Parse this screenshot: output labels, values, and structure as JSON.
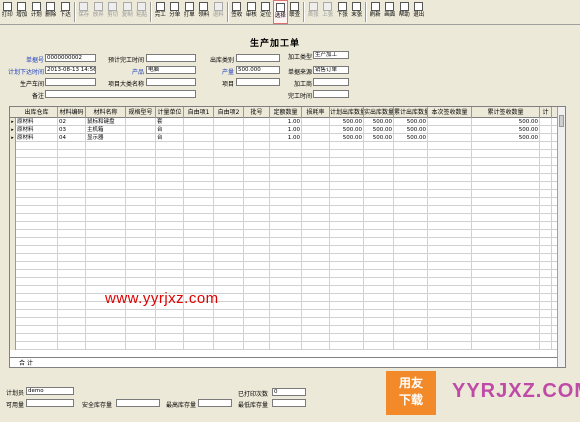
{
  "toolbar": {
    "buttons": [
      {
        "label": "打印",
        "icon": "printer-icon",
        "disabled": false
      },
      {
        "label": "增加",
        "icon": "add-icon",
        "disabled": false
      },
      {
        "label": "计划",
        "icon": "plan-icon",
        "disabled": false
      },
      {
        "label": "删除",
        "icon": "delete-icon",
        "disabled": false
      },
      {
        "label": "下达",
        "icon": "issue-icon",
        "disabled": false
      },
      {
        "label": "保存",
        "icon": "save-icon",
        "disabled": true
      },
      {
        "label": "放弃",
        "icon": "cancel-icon",
        "disabled": true
      },
      {
        "label": "剪切",
        "icon": "cut-icon",
        "disabled": true
      },
      {
        "label": "复制",
        "icon": "copy-icon",
        "disabled": true
      },
      {
        "label": "粘贴",
        "icon": "paste-icon",
        "disabled": true
      },
      {
        "label": "完工",
        "icon": "complete-icon",
        "disabled": false
      },
      {
        "label": "分单",
        "icon": "split-icon",
        "disabled": false
      },
      {
        "label": "打单",
        "icon": "print-order-icon",
        "disabled": false
      },
      {
        "label": "领料",
        "icon": "pick-material-icon",
        "disabled": false
      },
      {
        "label": "退料",
        "icon": "return-material-icon",
        "disabled": true
      },
      {
        "label": "签收",
        "icon": "sign-icon",
        "disabled": false
      },
      {
        "label": "审核",
        "icon": "audit-icon",
        "disabled": false
      },
      {
        "label": "定位",
        "icon": "locate-icon",
        "disabled": false
      },
      {
        "label": "选择",
        "icon": "select-icon",
        "disabled": false,
        "selected": true
      },
      {
        "label": "联查",
        "icon": "link-query-icon",
        "disabled": false
      },
      {
        "label": "首张",
        "icon": "first-icon",
        "disabled": true
      },
      {
        "label": "上张",
        "icon": "prev-icon",
        "disabled": true
      },
      {
        "label": "下张",
        "icon": "next-icon",
        "disabled": false
      },
      {
        "label": "末张",
        "icon": "last-icon",
        "disabled": false
      },
      {
        "label": "刷新",
        "icon": "refresh-icon",
        "disabled": false
      },
      {
        "label": "画面",
        "icon": "view-icon",
        "disabled": false
      },
      {
        "label": "帮助",
        "icon": "help-icon",
        "disabled": false
      },
      {
        "label": "退出",
        "icon": "exit-icon",
        "disabled": false
      }
    ]
  },
  "form": {
    "title": "生产加工单",
    "order_no_label": "单据号",
    "order_no": "0000000002",
    "plan_time_label": "计划下达时间",
    "plan_time": "2013-08-13 14:56",
    "workshop_label": "生产车间",
    "remark_label": "备注",
    "est_finish_label": "预计完工时间",
    "product_label": "产品",
    "product": "电脑",
    "project_label": "项目大类名称",
    "out_type_label": "出库类别",
    "project_item_label": "项目",
    "qty_label": "产量",
    "qty": "500.000",
    "process_type_label": "加工类型",
    "process_type": "生产加工",
    "source_label": "单据来源",
    "source": "销售订单",
    "processor_label": "加工商",
    "finish_time_label": "完工时间"
  },
  "table": {
    "columns": [
      "出库仓库",
      "材料编码",
      "材料名称",
      "规格型号",
      "计量单位",
      "自由项1",
      "自由项2",
      "批号",
      "定额数量",
      "损耗率",
      "计划出库数量",
      "实出库数量",
      "累计出库数量",
      "本次签收数量",
      "累计签收数量",
      "计"
    ],
    "rows": [
      {
        "marker": "▸",
        "cells": [
          "原材料",
          "02",
          "鼠标和键盘",
          "",
          "套",
          "",
          "",
          "",
          "1.00",
          "",
          "500.00",
          "500.00",
          "500.00",
          "",
          "500.00",
          ""
        ]
      },
      {
        "marker": "▸",
        "cells": [
          "原材料",
          "03",
          "主机箱",
          "",
          "台",
          "",
          "",
          "",
          "1.00",
          "",
          "500.00",
          "500.00",
          "500.00",
          "",
          "500.00",
          ""
        ]
      },
      {
        "marker": "▸",
        "cells": [
          "原材料",
          "04",
          "显示器",
          "",
          "台",
          "",
          "",
          "",
          "1.00",
          "",
          "500.00",
          "500.00",
          "500.00",
          "",
          "500.00",
          ""
        ]
      }
    ],
    "total_label": "合 计"
  },
  "footer": {
    "planner_label": "计划员",
    "planner": "demo",
    "available_label": "可用量",
    "safety_label": "安全库存量",
    "max_label": "最高库存量",
    "printed_label": "已打印次数",
    "printed": "0",
    "min_label": "最低库存量"
  },
  "watermark": "www.yyrjxz.com",
  "logo": {
    "line1": "用友",
    "line2": "下载",
    "text": "YYRJXZ.COM"
  }
}
